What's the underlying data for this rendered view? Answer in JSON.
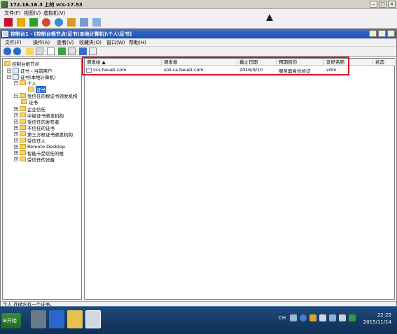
{
  "vm": {
    "title": "172.16.16.3 上的 vcs-17.53",
    "menu": [
      "文件(F)",
      "视图(V)",
      "虚拟机(V)"
    ]
  },
  "mmc": {
    "title": "控制台1 - [控制台根节点\\证书(本地计算机)\\个人\\证书]",
    "menu": [
      "文件(F)",
      "操作(A)",
      "查看(V)",
      "收藏夹(O)",
      "窗口(W)",
      "帮助(H)"
    ],
    "status": "个人 存储含有一个证书。"
  },
  "tree": {
    "root": "控制台根节点",
    "current_user": "证书 - 当前用户",
    "local_machine": "证书(本地计算机)",
    "personal": "个人",
    "personal_certs": "证书",
    "trusted_root": "受信任的根证书颁发机构",
    "trusted_root_certs": "证书",
    "others": [
      "企业信任",
      "中级证书颁发机构",
      "受信任的发布者",
      "不信任的证书",
      "第三方根证书颁发机构",
      "受信任人",
      "Remote Desktop",
      "智能卡受信任的根",
      "受信任的设备"
    ]
  },
  "list": {
    "columns": [
      "颁发给 ▲",
      "颁发者",
      "截止日期",
      "预期目的",
      "友好名称",
      "状态"
    ],
    "rows": [
      {
        "issued_to": "vcs.heuet.com",
        "issuer": "std-ca.heuet.com",
        "expiry": "2016/9/10",
        "purpose": "服务器身份验证",
        "friendly": "vdm",
        "status": ""
      }
    ]
  },
  "taskbar": {
    "start": "开始",
    "ch": "CH",
    "time": "22:22",
    "date": "2015/11/14"
  },
  "colors": {
    "highlight": "#e0102a",
    "title_blue": "#1a4fb0",
    "selection": "#3169c6"
  }
}
